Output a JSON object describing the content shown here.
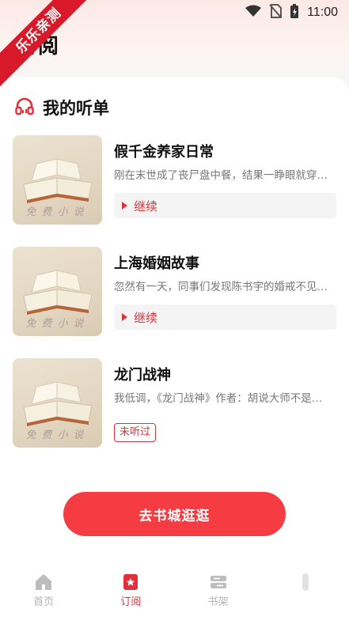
{
  "status_bar": {
    "time": "11:00"
  },
  "corner_banner": {
    "text": "乐乐亲测"
  },
  "page": {
    "title": "订阅"
  },
  "section": {
    "title": "我的听单"
  },
  "books": [
    {
      "title": "假千金养家日常",
      "desc": "刚在末世成了丧尸盘中餐，结果一睁眼就穿…",
      "action": "继续",
      "cover_text": "免费小说"
    },
    {
      "title": "上海婚姻故事",
      "desc": "忽然有一天，同事们发现陈书宇的婚戒不见…",
      "action": "继续",
      "cover_text": "免费小说"
    },
    {
      "title": "龙门战神",
      "desc": "我低调，《龙门战神》作者：胡说大师不是…",
      "badge": "未听过",
      "cover_text": "免费小说"
    }
  ],
  "cta": {
    "label": "去书城逛逛"
  },
  "tabbar": {
    "items": [
      {
        "label": "首页",
        "icon": "home-icon",
        "active": false
      },
      {
        "label": "订阅",
        "icon": "bookmark-icon",
        "active": true
      },
      {
        "label": "书架",
        "icon": "bookshelf-icon",
        "active": false
      },
      {
        "label": "",
        "icon": "profile-icon",
        "active": false
      }
    ]
  },
  "colors": {
    "accent": "#e0313a",
    "cta": "#f43c42",
    "ribbon": "#d7192a"
  }
}
